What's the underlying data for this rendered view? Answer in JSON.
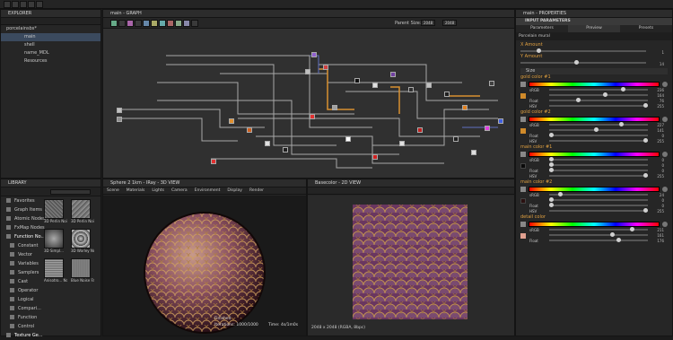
{
  "explorer": {
    "title": "EXPLORER",
    "package": "porcelainsbs*",
    "items": [
      "main",
      "shell",
      "name_MDL",
      "Resources"
    ]
  },
  "graph": {
    "title": "main - GRAPH",
    "parent_size_label": "Parent Size:",
    "size_x": "2048",
    "size_y": "2048"
  },
  "library": {
    "title": "LIBRARY",
    "categories": [
      "Favorites",
      "Graph Items",
      "Atomic Nodes",
      "FxMap Nodes",
      "Function No...",
      "Constant",
      "Vector",
      "Variables",
      "Samplers",
      "Cast",
      "Operator",
      "Logical",
      "Compari...",
      "Function",
      "Control",
      "Texture Ge...",
      "Noises",
      "Patterns"
    ],
    "thumbs": [
      "3D Perlin Noise",
      "3D Perlin Noise ...",
      "3D Simpl...",
      "3D Worley Noise",
      "Anisotro... Noise",
      "Blue Noise Fast"
    ]
  },
  "view3d": {
    "title": "Sphere 2 1km - IRay - 3D VIEW",
    "menu": [
      "Scene",
      "Materials",
      "Lights",
      "Camera",
      "Environment",
      "Display",
      "Render"
    ],
    "status_line1": "Finished",
    "status_line2": "Iterations: 1000/1000",
    "status_time": "Time: 4s/1m0s"
  },
  "view2d": {
    "title": "Basecolor - 2D VIEW",
    "status": "2048 x 2048 (RGBA, 8bpc)"
  },
  "properties": {
    "title": "main - PROPERTIES",
    "section": "INPUT PARAMETERS",
    "tabs": [
      "Parameters",
      "Preview",
      "Presets"
    ],
    "preset": "Porcelain mural",
    "x_amount_label": "X Amount",
    "x_amount": "1",
    "y_amount_label": "Y Amount",
    "y_amount": "14",
    "size_label": "Size",
    "colors": [
      {
        "name": "gold color #1",
        "swatch": "#d08a2a",
        "r": "236",
        "g": "164",
        "b": "76",
        "hsv": "255"
      },
      {
        "name": "gold color #2",
        "swatch": "#d08a2a",
        "r": "227",
        "g": "141",
        "b": "0",
        "hsv": "255"
      },
      {
        "name": "main color #1",
        "swatch": "#0a0a0a",
        "r": "0",
        "g": "0",
        "b": "0",
        "hsv": "255"
      },
      {
        "name": "main color #2",
        "swatch": "#2a1010",
        "r": "24",
        "g": "0",
        "b": "0",
        "hsv": "255"
      },
      {
        "name": "detail color",
        "swatch": "#e0a090",
        "r": "211",
        "g": "161",
        "b": "176",
        "hsv": "255"
      }
    ],
    "mode_label": "sRGB",
    "float_label": "Float",
    "h_label": "H",
    "s_label": "S",
    "v_label": "V",
    "hsv_label": "HSV"
  },
  "accent": "#3b4a5e",
  "label_color": "#e0a040"
}
